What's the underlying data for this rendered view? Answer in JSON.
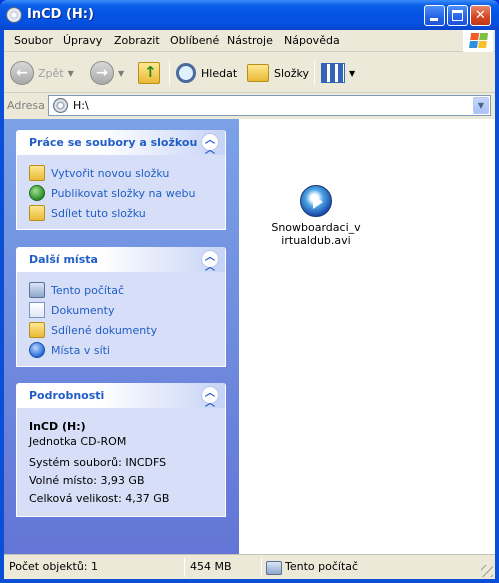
{
  "window": {
    "title": "InCD (H:)",
    "icons": {
      "title": "cd-drive-icon",
      "minimize": "minimize-icon",
      "maximize": "maximize-icon",
      "close": "close-icon"
    }
  },
  "menu": [
    {
      "label": "Soubor"
    },
    {
      "label": "Úpravy"
    },
    {
      "label": "Zobrazit"
    },
    {
      "label": "Oblíbené"
    },
    {
      "label": "Nástroje"
    },
    {
      "label": "Nápověda"
    }
  ],
  "toolbar": {
    "back_label": "Zpět",
    "search_label": "Hledat",
    "folders_label": "Složky"
  },
  "address": {
    "label": "Adresa",
    "value": "H:\\"
  },
  "tasks": {
    "files_header": "Práce se soubory a složkou",
    "files_items": [
      {
        "label": "Vytvořit novou složku",
        "icon": "new-folder-icon"
      },
      {
        "label": "Publikovat složky na webu",
        "icon": "publish-web-icon"
      },
      {
        "label": "Sdílet tuto složku",
        "icon": "share-folder-icon"
      }
    ],
    "places_header": "Další místa",
    "places_items": [
      {
        "label": "Tento počítač",
        "icon": "my-computer-icon"
      },
      {
        "label": "Dokumenty",
        "icon": "documents-icon"
      },
      {
        "label": "Sdílené dokumenty",
        "icon": "shared-documents-icon"
      },
      {
        "label": "Místa v síti",
        "icon": "network-places-icon"
      }
    ],
    "details_header": "Podrobnosti",
    "details": {
      "name": "InCD (H:)",
      "type": "Jednotka CD-ROM",
      "filesystem": "Systém souborů: INCDFS",
      "free": "Volné místo: 3,93 GB",
      "total": "Celková velikost: 4,37 GB"
    }
  },
  "files": [
    {
      "name": "Snowboardaci_virtualdub.avi",
      "icon": "video-file-icon"
    }
  ],
  "status": {
    "count": "Počet objektů: 1",
    "size": "454 MB",
    "location": "Tento počítač"
  },
  "colors": {
    "title_blue": "#0553e2",
    "task_text": "#215dc6",
    "pane_gradient_top": "#7ba2e7",
    "pane_gradient_bottom": "#6375d6"
  }
}
